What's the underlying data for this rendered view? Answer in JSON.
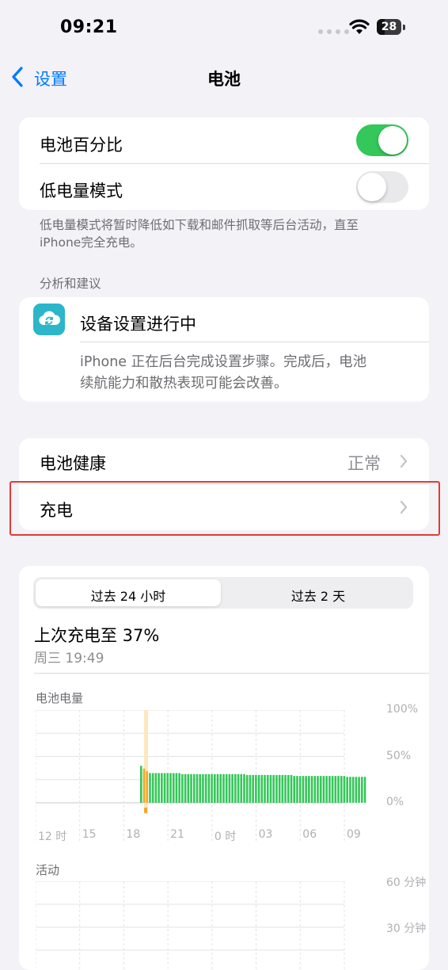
{
  "status_bar": {
    "time": "09:21",
    "battery_level": "28"
  },
  "nav": {
    "back_label": "设置",
    "title": "电池"
  },
  "toggles": [
    {
      "label": "电池百分比",
      "on": true
    },
    {
      "label": "低电量模式",
      "on": false
    }
  ],
  "low_power_footnote": [
    "低电量模式将暂时降低如下载和邮件抓取等后台活动，直至",
    "iPhone完全充电。"
  ],
  "analysis": {
    "header": "分析和建议",
    "title": "设备设置进行中",
    "description": [
      "iPhone 正在后台完成设置步骤。完成后，电池",
      "续航能力和散热表现可能会改善。"
    ]
  },
  "health": {
    "label": "电池健康",
    "value": "正常"
  },
  "charging": {
    "label": "充电"
  },
  "usage": {
    "tabs": [
      "过去 24 小时",
      "过去 2 天"
    ],
    "selected_tab": 0,
    "last_charge_title": "上次充电至 37%",
    "last_charge_time": "周三 19:49",
    "battery_chart_label": "电池电量",
    "activity_chart_label": "活动",
    "colors": {
      "battery": "#34c759",
      "charging": "#f5a623",
      "charging_band": "#fde7c0"
    }
  },
  "chart_data": [
    {
      "type": "bar",
      "title": "电池电量",
      "x_tick_labels": [
        "12 时",
        "15",
        "18",
        "21",
        "0 时",
        "03",
        "06",
        "09"
      ],
      "y_tick_labels": [
        "100%",
        "50%",
        "0%"
      ],
      "ylim": [
        0,
        100
      ],
      "series": [
        {
          "values": [
            40,
            37,
            34,
            32,
            32,
            32,
            32,
            32,
            32,
            32,
            32,
            32,
            32,
            32,
            31,
            31,
            31,
            31,
            31,
            31,
            31,
            31,
            31,
            31,
            31,
            31,
            31,
            31,
            31,
            31,
            31,
            31,
            31,
            31,
            31,
            31,
            30,
            30,
            30,
            30,
            30,
            30,
            30,
            30,
            30,
            30,
            30,
            30,
            30,
            30,
            30,
            30,
            29,
            29,
            29,
            29,
            29,
            29,
            29,
            29,
            29,
            29,
            29,
            29,
            29,
            29,
            29,
            29,
            29,
            29,
            28,
            28,
            28,
            28,
            28,
            28,
            28
          ]
        }
      ],
      "charging_highlight_bars": [
        1,
        2
      ]
    },
    {
      "type": "bar",
      "title": "活动",
      "y_tick_labels": [
        "60 分钟",
        "30 分钟"
      ],
      "series": []
    }
  ]
}
